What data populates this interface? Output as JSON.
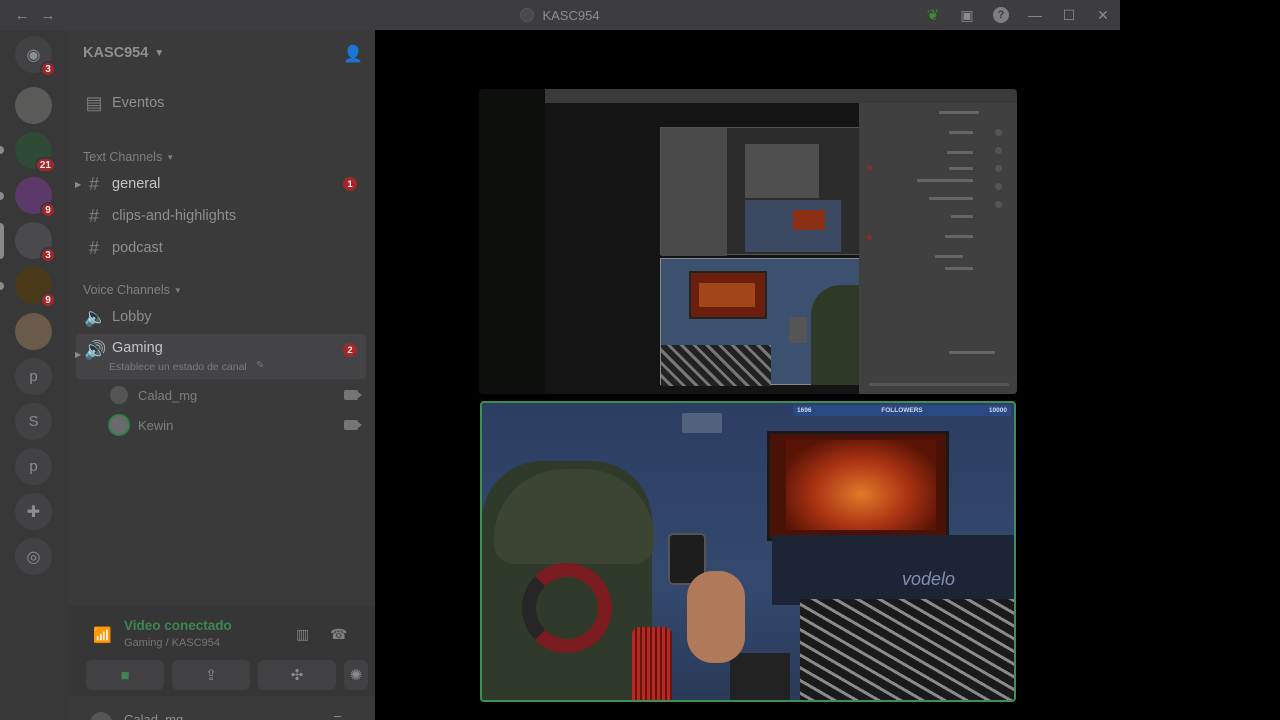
{
  "window": {
    "title": "KASC954",
    "back_icon": "←",
    "forward_icon": "→"
  },
  "titlebar_icons": [
    "leaf-icon",
    "inbox-icon",
    "help-icon",
    "minimize-icon",
    "maximize-icon",
    "close-icon"
  ],
  "rail": {
    "home_badge": "3",
    "servers": [
      {
        "name": "server-1",
        "badge": ""
      },
      {
        "name": "server-2",
        "badge": "21"
      },
      {
        "name": "server-3",
        "badge": "9"
      },
      {
        "name": "server-4",
        "badge": "3"
      },
      {
        "name": "server-5",
        "badge": "9"
      },
      {
        "name": "server-6",
        "badge": ""
      }
    ],
    "text_servers": [
      "p",
      "S",
      "p"
    ]
  },
  "sidebar": {
    "guild_name": "KASC954",
    "events_label": "Eventos",
    "text_category": "Text Channels",
    "text_channels": [
      {
        "name": "general",
        "badge": "1"
      },
      {
        "name": "clips-and-highlights",
        "badge": ""
      },
      {
        "name": "podcast",
        "badge": ""
      }
    ],
    "voice_category": "Voice Channels",
    "voice_channels": [
      {
        "name": "Lobby"
      },
      {
        "name": "Gaming",
        "badge": "2",
        "status": "Establece un estado de canal"
      }
    ],
    "voice_users": [
      {
        "name": "Calad_mg"
      },
      {
        "name": "Kewin"
      }
    ]
  },
  "voice_panel": {
    "title": "Video conectado",
    "subtitle": "Gaming / KASC954"
  },
  "user_bar": {
    "name": "Calad_mg"
  },
  "stage": {
    "followers_left": "1696",
    "followers_label": "FOLLOWERS",
    "followers_right": "10000",
    "neon_text": "vodelo"
  },
  "colors": {
    "connected_green": "#3f8550",
    "badge_red": "#a3262a",
    "speaking_border": "#3f8f55"
  }
}
